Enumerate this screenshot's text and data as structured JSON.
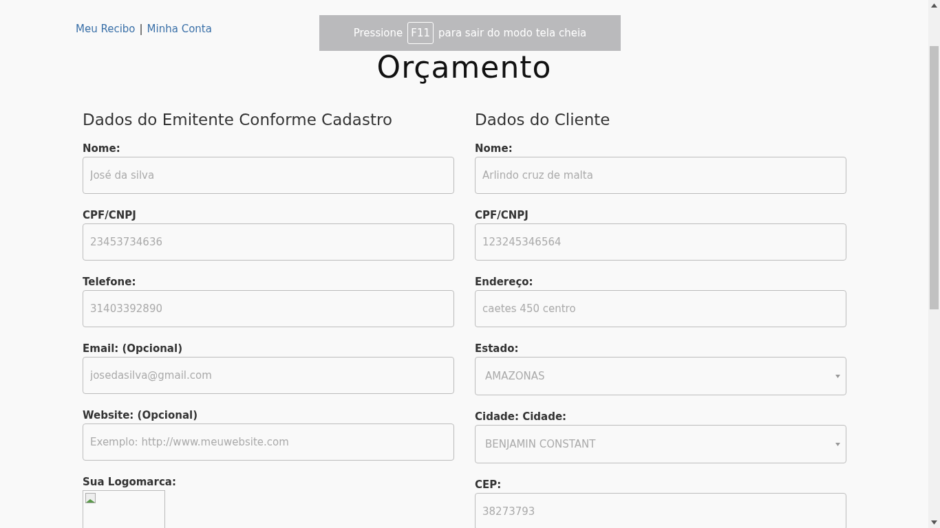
{
  "nav_links": [
    {
      "label": "Meu Recibo"
    },
    {
      "label": "Minha Conta"
    }
  ],
  "nav_separator": "|",
  "title": "Orçamento",
  "fullscreen_notice": {
    "before": "Pressione",
    "key": "F11",
    "after": "para sair do modo tela cheia"
  },
  "columns": [
    {
      "heading": "Dados do Emitente Conforme Cadastro",
      "fields": [
        {
          "kind": "input",
          "label": "Nome:",
          "placeholder": "José da silva"
        },
        {
          "kind": "input",
          "label": "CPF/CNPJ",
          "placeholder": "23453734636"
        },
        {
          "kind": "input",
          "label": "Telefone:",
          "placeholder": "31403392890"
        },
        {
          "kind": "input",
          "label": "Email: (Opcional)",
          "placeholder": "josedasilva@gmail.com"
        },
        {
          "kind": "input",
          "label": "Website: (Opcional)",
          "placeholder": "Exemplo: http://www.meuwebsite.com"
        },
        {
          "kind": "image",
          "label": "Sua Logomarca:"
        }
      ]
    },
    {
      "heading": "Dados do Cliente",
      "fields": [
        {
          "kind": "input",
          "label": "Nome:",
          "placeholder": "Arlindo cruz de malta"
        },
        {
          "kind": "input",
          "label": "CPF/CNPJ",
          "placeholder": "123245346564"
        },
        {
          "kind": "input",
          "label": "Endereço:",
          "placeholder": "caetes 450 centro"
        },
        {
          "kind": "select",
          "label": "Estado:",
          "value": "AMAZONAS"
        },
        {
          "kind": "select",
          "label": "Cidade: Cidade:",
          "value": "BENJAMIN CONSTANT"
        },
        {
          "kind": "input",
          "label": "CEP:",
          "placeholder": "38273793"
        }
      ]
    }
  ]
}
